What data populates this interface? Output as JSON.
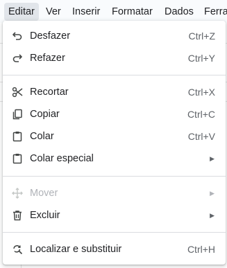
{
  "menubar": {
    "items": [
      {
        "label": "Editar"
      },
      {
        "label": "Ver"
      },
      {
        "label": "Inserir"
      },
      {
        "label": "Formatar"
      },
      {
        "label": "Dados"
      },
      {
        "label": "Ferra"
      }
    ]
  },
  "edit_menu": {
    "items": [
      {
        "label": "Desfazer",
        "shortcut": "Ctrl+Z",
        "icon": "undo-icon"
      },
      {
        "label": "Refazer",
        "shortcut": "Ctrl+Y",
        "icon": "redo-icon"
      },
      {
        "label": "Recortar",
        "shortcut": "Ctrl+X",
        "icon": "scissors-icon"
      },
      {
        "label": "Copiar",
        "shortcut": "Ctrl+C",
        "icon": "copy-icon"
      },
      {
        "label": "Colar",
        "shortcut": "Ctrl+V",
        "icon": "clipboard-icon"
      },
      {
        "label": "Colar especial",
        "submenu_arrow": "▶",
        "icon": "clipboard-icon"
      },
      {
        "label": "Mover",
        "submenu_arrow": "▶",
        "icon": "move-icon",
        "disabled": true
      },
      {
        "label": "Excluir",
        "submenu_arrow": "▶",
        "icon": "trash-icon"
      },
      {
        "label": "Localizar e substituir",
        "shortcut": "Ctrl+H",
        "icon": "find-replace-icon"
      }
    ]
  },
  "colors": {
    "text": "#202124",
    "shortcut": "#5f6368",
    "disabled": "#b0b3b8",
    "active_menu_bg": "#e1e5ea"
  }
}
